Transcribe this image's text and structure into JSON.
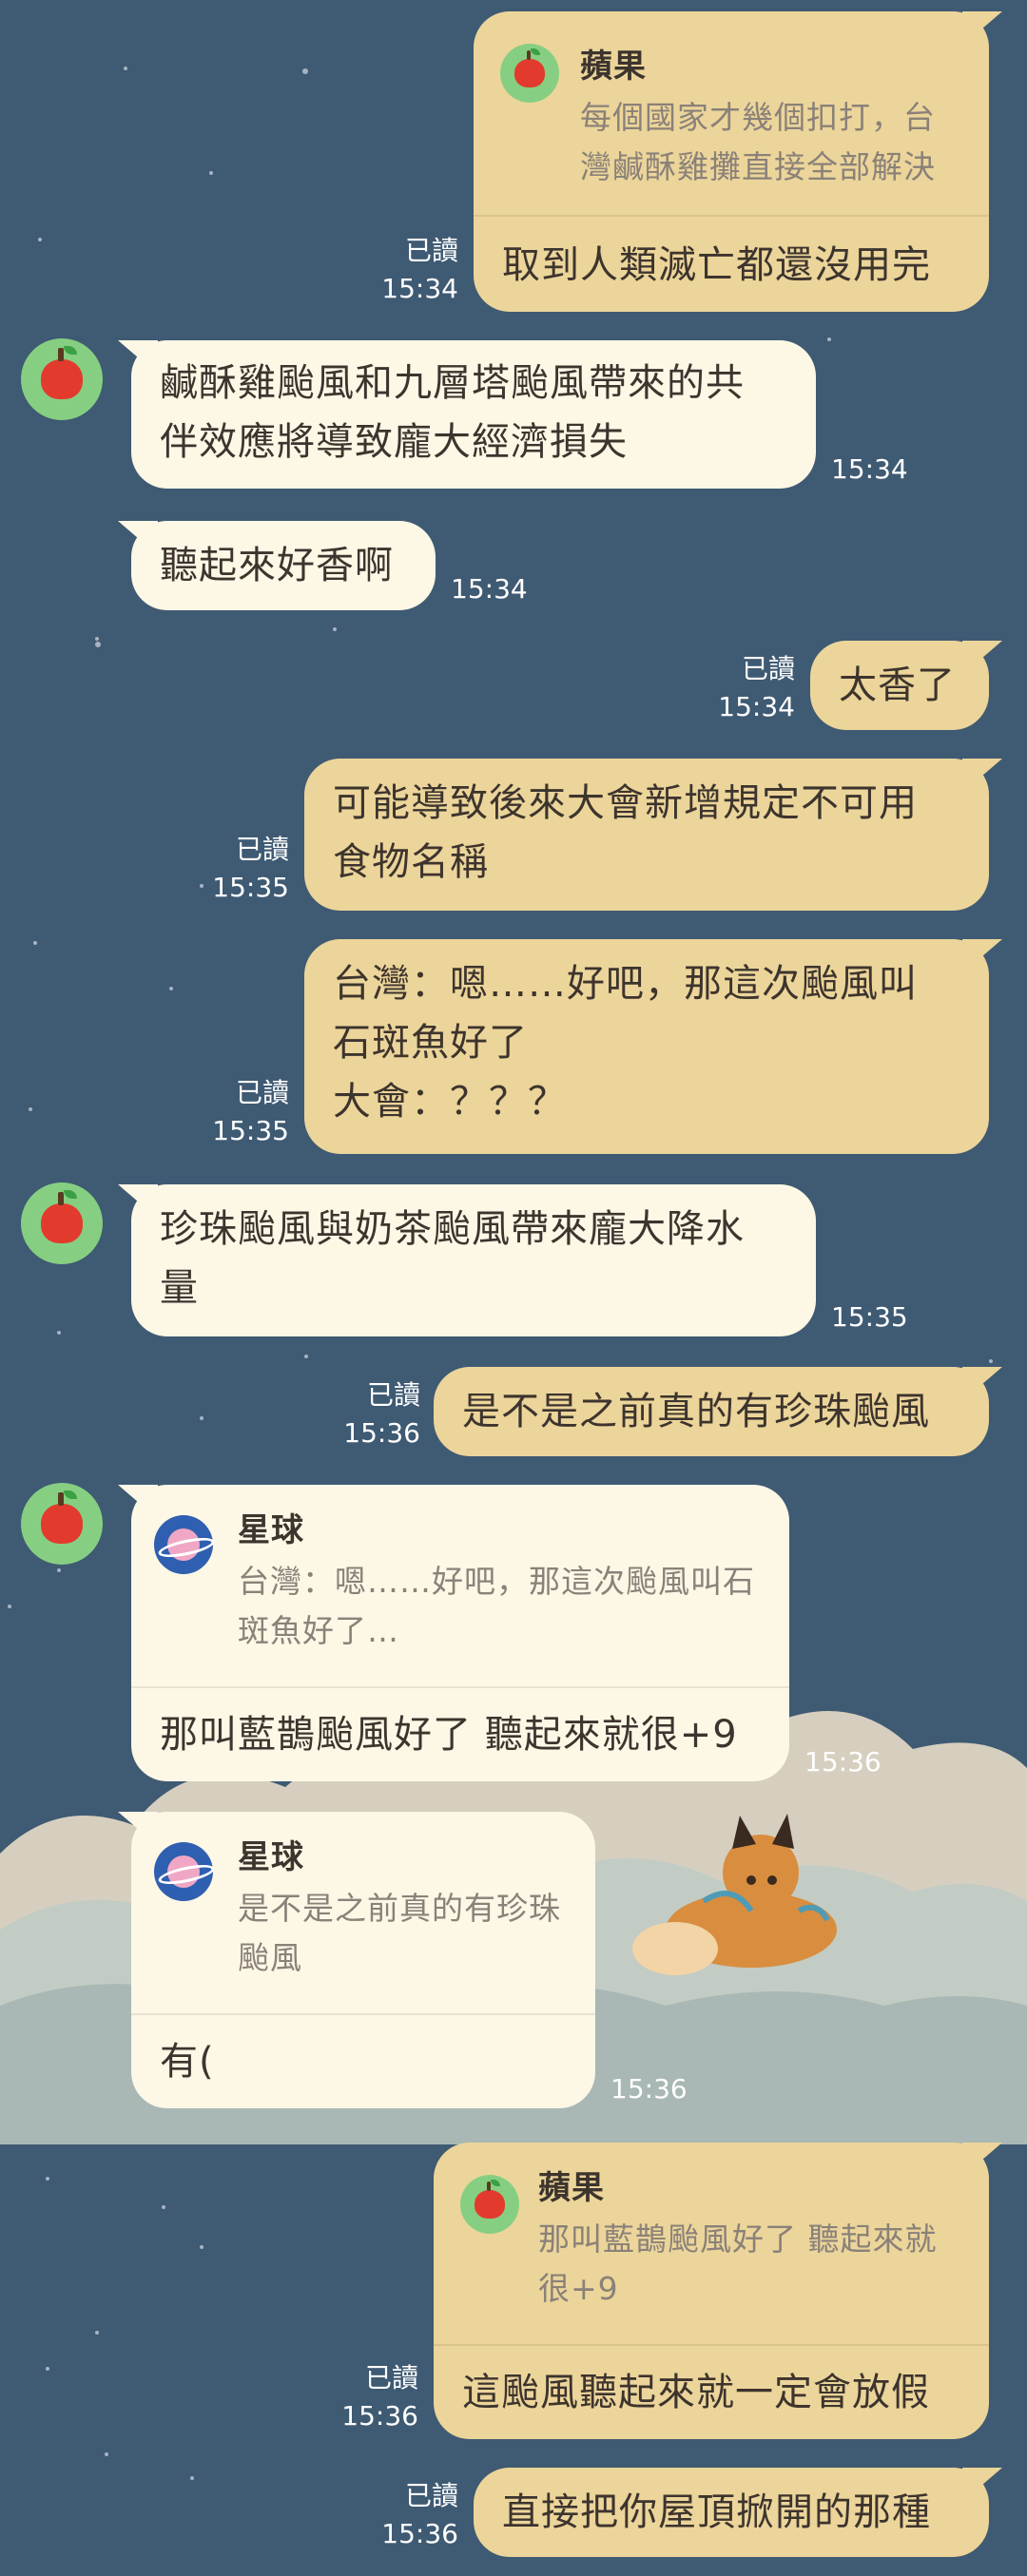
{
  "colors": {
    "background": "#3f5a73",
    "incoming_bubble": "#fdf7e6",
    "outgoing_bubble": "#ecd59a",
    "text": "#3d342e",
    "quote_text": "#8a8179"
  },
  "icons": {
    "apple_avatar": "apple-icon",
    "planet_avatar": "planet-icon"
  },
  "messages": [
    {
      "side": "out",
      "quote": {
        "name": "蘋果",
        "line1": "每個國家才幾個扣打，台",
        "line2": "灣鹹酥雞攤直接全部解決"
      },
      "text": "取到人類滅亡都還沒用完",
      "read": "已讀",
      "time": "15:34"
    },
    {
      "side": "in",
      "line1": "鹹酥雞颱風和九層塔颱風帶來的共",
      "line2": "伴效應將導致龐大經濟損失",
      "time": "15:34"
    },
    {
      "side": "in",
      "text": "聽起來好香啊",
      "time": "15:34"
    },
    {
      "side": "out",
      "text": "太香了",
      "read": "已讀",
      "time": "15:34"
    },
    {
      "side": "out",
      "line1": "可能導致後來大會新增規定不可用",
      "line2": "食物名稱",
      "read": "已讀",
      "time": "15:35"
    },
    {
      "side": "out",
      "line1": "台灣：嗯……好吧，那這次颱風叫",
      "line2": "石斑魚好了",
      "line3": "大會：？？？",
      "read": "已讀",
      "time": "15:35"
    },
    {
      "side": "in",
      "line1": "珍珠颱風與奶茶颱風帶來龐大降水",
      "line2": "量",
      "time": "15:35"
    },
    {
      "side": "out",
      "text": "是不是之前真的有珍珠颱風",
      "read": "已讀",
      "time": "15:36"
    },
    {
      "side": "in",
      "quote": {
        "name": "星球",
        "line1": "台灣：嗯……好吧，那這次颱風叫石",
        "line2": "斑魚好了…"
      },
      "text": "那叫藍鵲颱風好了 聽起來就很+9",
      "time": "15:36"
    },
    {
      "side": "in",
      "quote": {
        "name": "星球",
        "line1": "是不是之前真的有珍珠",
        "line2": "颱風"
      },
      "text": "有(",
      "time": "15:36"
    },
    {
      "side": "out",
      "quote": {
        "name": "蘋果",
        "line1": "那叫藍鵲颱風好了 聽起來就",
        "line2": "很+9"
      },
      "text": "這颱風聽起來就一定會放假",
      "read": "已讀",
      "time": "15:36"
    },
    {
      "side": "out",
      "text": "直接把你屋頂掀開的那種",
      "read": "已讀",
      "time": "15:36"
    }
  ]
}
